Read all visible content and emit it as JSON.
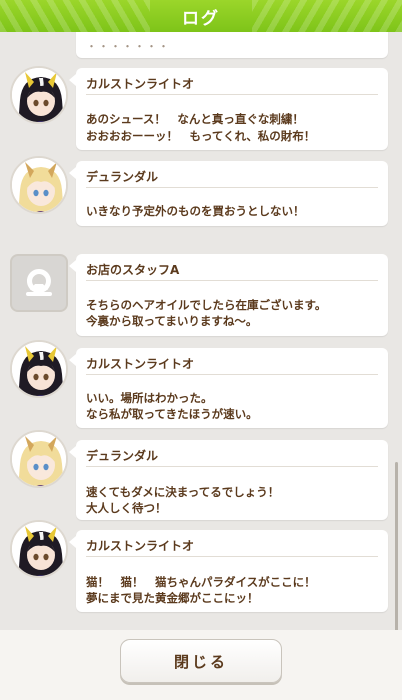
{
  "header": {
    "title": "ログ"
  },
  "log": {
    "cutoff_text": "・・・・・・・",
    "entries": [
      {
        "speaker": "カルストンライトオ",
        "avatar": "dark-hair-horse-girl-avatar",
        "lines": [
          "あのシュース！　なんと真っ直ぐな刺繍！",
          "おおおおーーッ！　もってくれ、私の財布！"
        ]
      },
      {
        "speaker": "デュランダル",
        "avatar": "blonde-horse-girl-avatar",
        "lines": [
          "いきなり予定外のものを買おうとしない！"
        ]
      },
      {
        "speaker": "お店のスタッフA",
        "avatar": "staff-placeholder-icon",
        "lines": [
          "そちらのヘアオイルでしたら在庫ございます。",
          "今裏から取ってまいりますね〜。"
        ]
      },
      {
        "speaker": "カルストンライトオ",
        "avatar": "dark-hair-horse-girl-avatar",
        "lines": [
          "いい。場所はわかった。",
          "なら私が取ってきたほうが速い。"
        ]
      },
      {
        "speaker": "デュランダル",
        "avatar": "blonde-horse-girl-avatar",
        "lines": [
          "速くてもダメに決まってるでしょう！",
          "大人しく待つ！"
        ]
      },
      {
        "speaker": "カルストンライトオ",
        "avatar": "dark-hair-horse-girl-avatar",
        "lines": [
          "猫！　猫！　猫ちゃんパラダイスがここに！",
          "夢にまで見た黄金郷がここにッ！"
        ]
      }
    ]
  },
  "footer": {
    "close_label": "閉じる"
  },
  "colors": {
    "header_green": "#8ccd22",
    "text_brown": "#5b3a1d"
  }
}
